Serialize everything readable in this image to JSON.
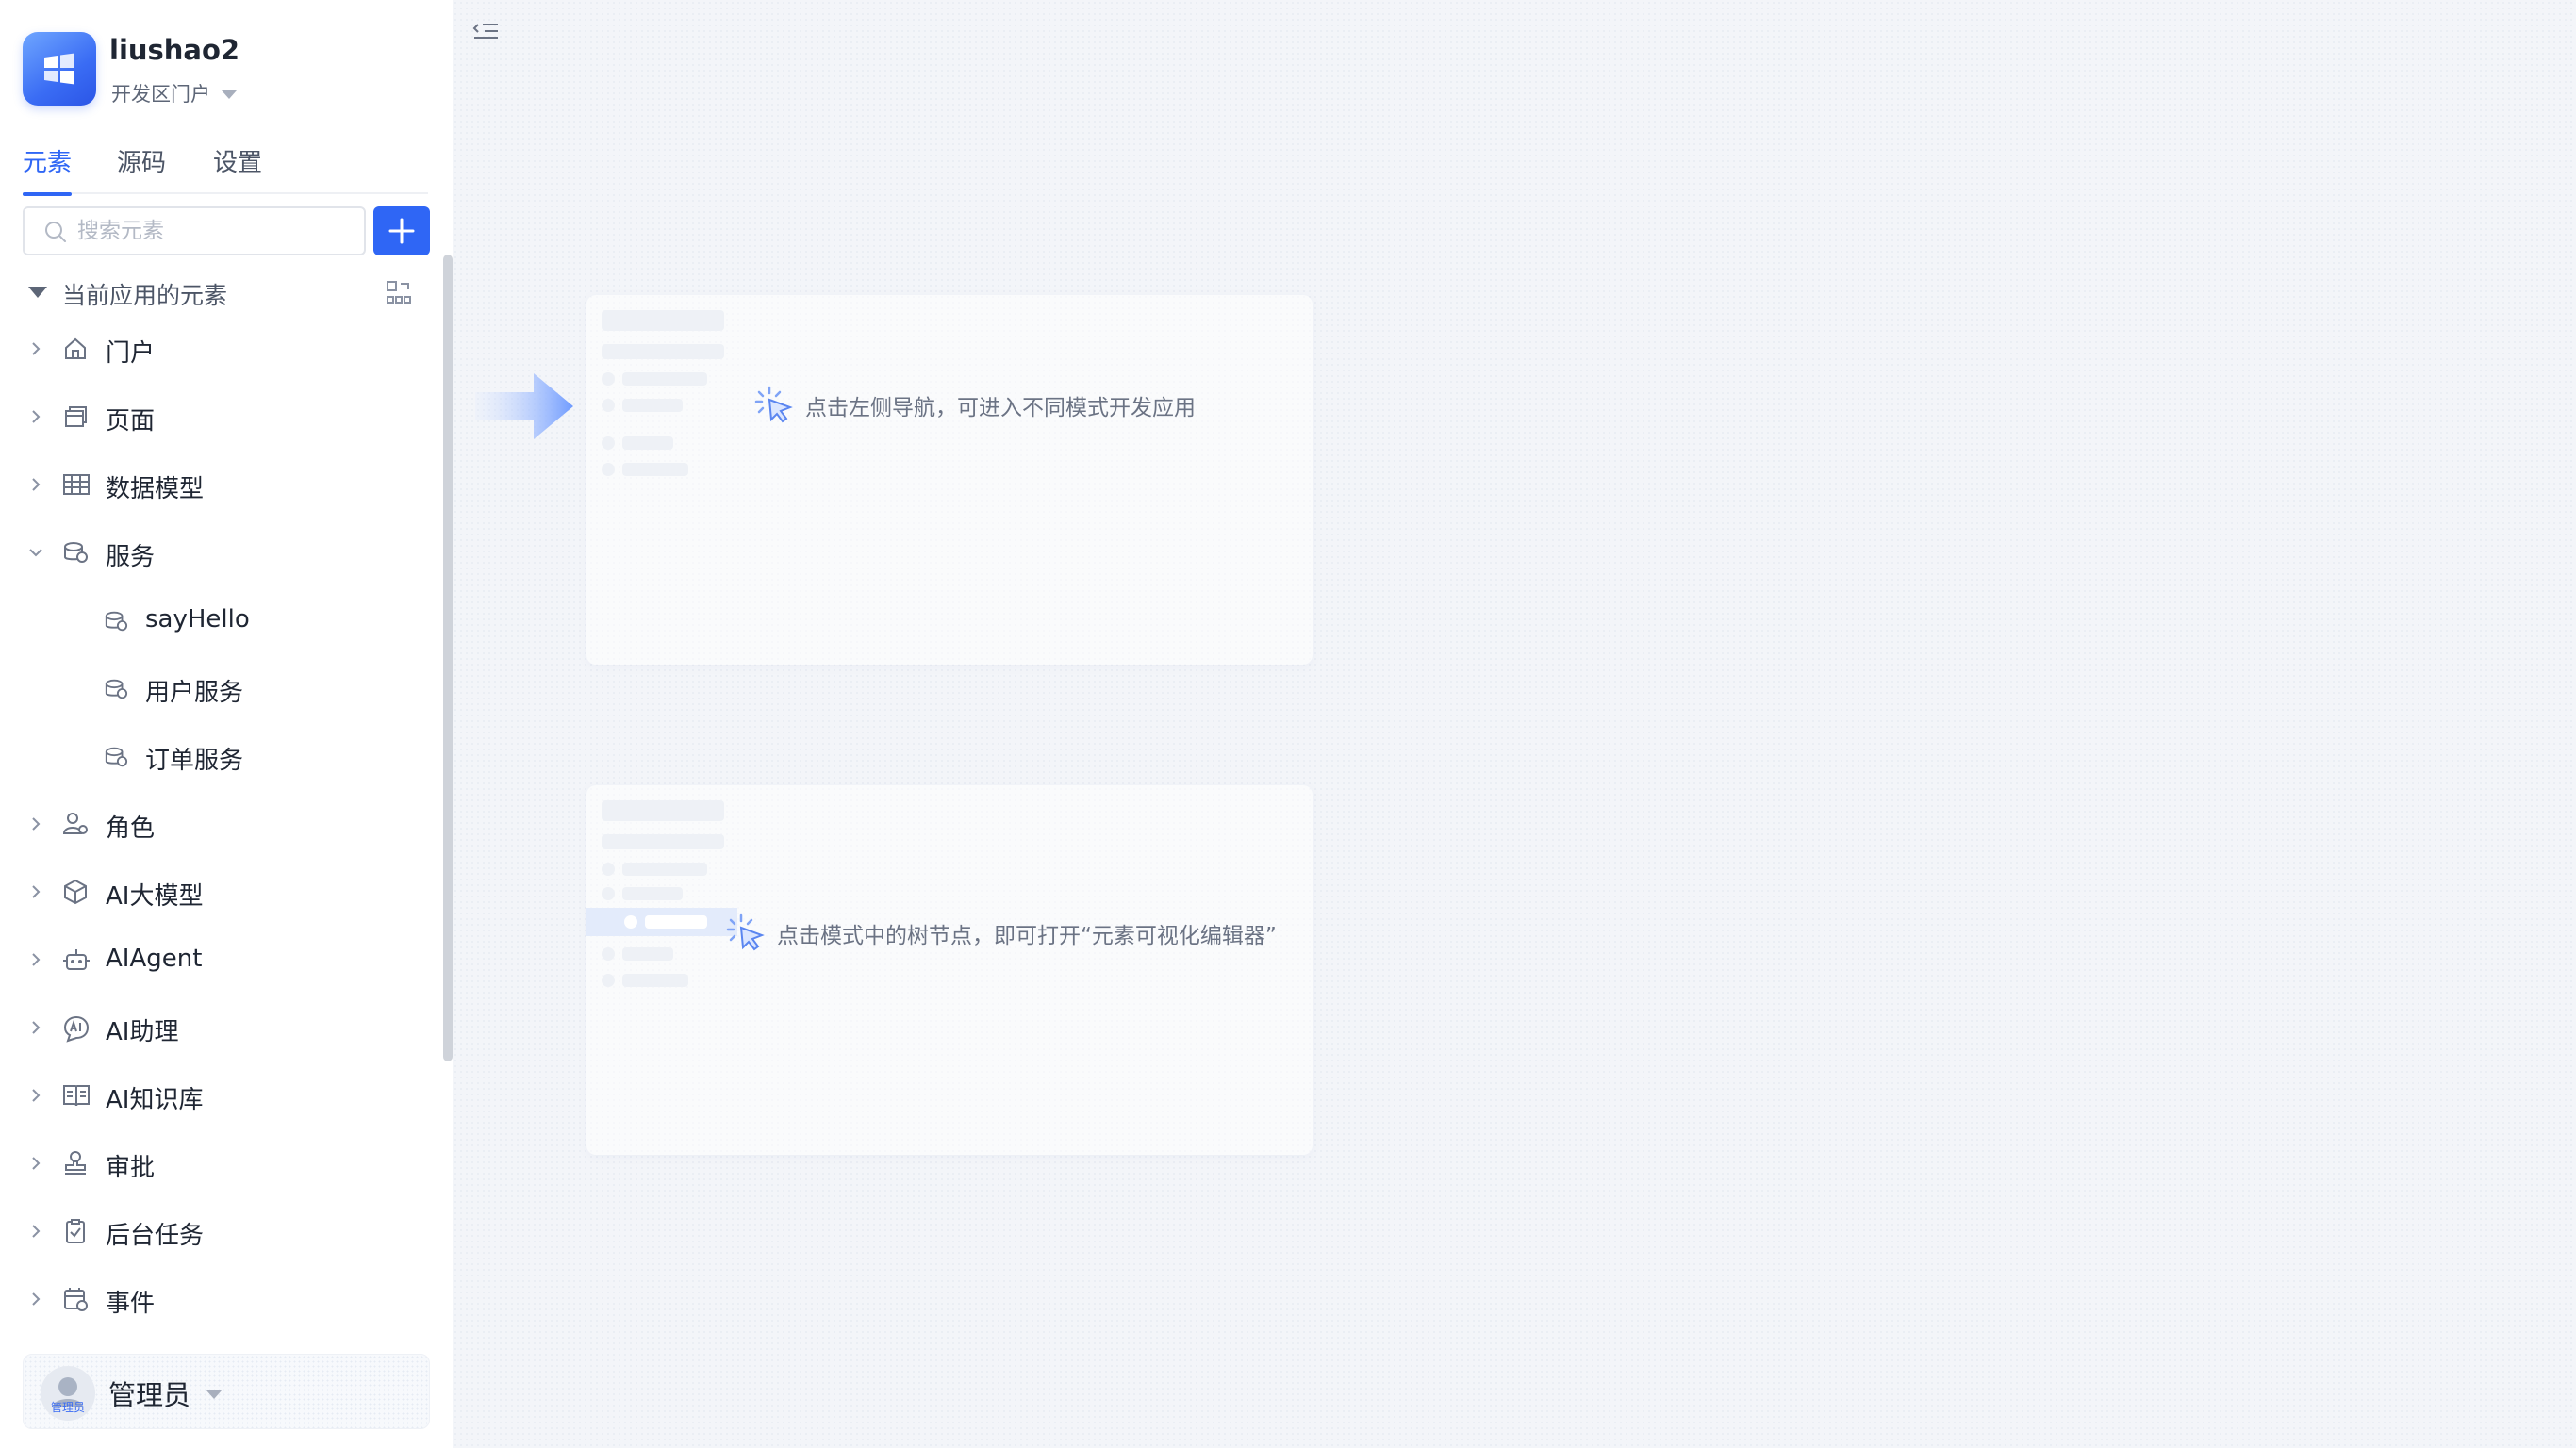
{
  "app": {
    "name": "liushao2",
    "environment": "开发区门户"
  },
  "tabs": [
    {
      "label": "元素",
      "active": true
    },
    {
      "label": "源码",
      "active": false
    },
    {
      "label": "设置",
      "active": false
    }
  ],
  "search": {
    "placeholder": "搜索元素",
    "value": ""
  },
  "tree": {
    "section_label": "当前应用的元素",
    "items": [
      {
        "label": "门户",
        "icon": "home-icon",
        "expanded": false
      },
      {
        "label": "页面",
        "icon": "page-icon",
        "expanded": false
      },
      {
        "label": "数据模型",
        "icon": "table-icon",
        "expanded": false
      },
      {
        "label": "服务",
        "icon": "service-icon",
        "expanded": true,
        "children": [
          {
            "label": "sayHello",
            "icon": "service-icon"
          },
          {
            "label": "用户服务",
            "icon": "service-icon"
          },
          {
            "label": "订单服务",
            "icon": "service-icon"
          }
        ]
      },
      {
        "label": "角色",
        "icon": "role-icon",
        "expanded": false
      },
      {
        "label": "AI大模型",
        "icon": "cube-icon",
        "expanded": false
      },
      {
        "label": "AIAgent",
        "icon": "robot-icon",
        "expanded": false
      },
      {
        "label": "AI助理",
        "icon": "ai-assistant-icon",
        "expanded": false
      },
      {
        "label": "AI知识库",
        "icon": "book-icon",
        "expanded": false
      },
      {
        "label": "审批",
        "icon": "stamp-icon",
        "expanded": false
      },
      {
        "label": "后台任务",
        "icon": "task-icon",
        "expanded": false
      },
      {
        "label": "事件",
        "icon": "event-icon",
        "expanded": false
      }
    ]
  },
  "user": {
    "name": "管理员",
    "avatar_label": "管理员"
  },
  "main": {
    "hint_nav": "点击左侧导航，可进入不同模式开发应用",
    "hint_tree": "点击模式中的树节点，即可打开“元素可视化编辑器”"
  },
  "colors": {
    "accent": "#2f66f5",
    "text": "#1f2633",
    "muted": "#6b7384",
    "background": "#f3f5f9"
  }
}
